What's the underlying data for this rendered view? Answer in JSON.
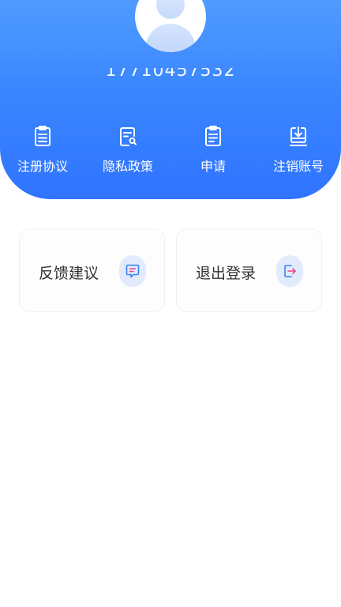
{
  "profile": {
    "phone": "17710457532"
  },
  "menu": {
    "items": [
      {
        "label": "注册协议",
        "icon": "clipboard-icon"
      },
      {
        "label": "隐私政策",
        "icon": "document-search-icon"
      },
      {
        "label": "申请",
        "icon": "clipboard-list-icon"
      },
      {
        "label": "注销账号",
        "icon": "download-tray-icon"
      }
    ]
  },
  "cards": {
    "feedback": {
      "label": "反馈建议",
      "icon": "message-icon"
    },
    "logout": {
      "label": "退出登录",
      "icon": "logout-icon"
    }
  },
  "colors": {
    "header_top": "#4f9bff",
    "header_bottom": "#2f74ff",
    "accent_pink": "#f0458a",
    "icon_bg": "#e1ebfc"
  }
}
